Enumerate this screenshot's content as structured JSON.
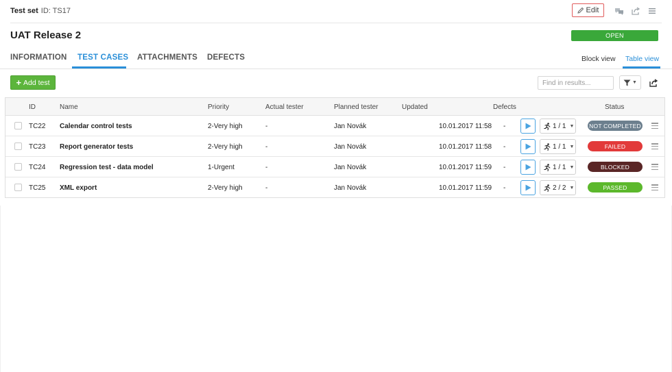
{
  "header": {
    "section_label": "Test set",
    "id_text": "ID: TS17",
    "edit_label": "Edit",
    "icons": [
      "comments-icon",
      "share-icon",
      "menu-icon"
    ]
  },
  "page": {
    "title": "UAT Release 2",
    "status": "OPEN",
    "status_color": "#3aa83a"
  },
  "tabs": [
    {
      "label": "INFORMATION",
      "active": false
    },
    {
      "label": "TEST CASES",
      "active": true
    },
    {
      "label": "ATTACHMENTS",
      "active": false
    },
    {
      "label": "DEFECTS",
      "active": false
    }
  ],
  "views": [
    {
      "label": "Block view",
      "active": false
    },
    {
      "label": "Table view",
      "active": true
    }
  ],
  "toolbar": {
    "add_label": "Add test",
    "search_placeholder": "Find in results...",
    "accent": "#2a8fd8"
  },
  "table": {
    "columns": [
      "ID",
      "Name",
      "Priority",
      "Actual tester",
      "Planned tester",
      "Updated",
      "Defects",
      "Status"
    ],
    "rows": [
      {
        "id": "TC22",
        "name": "Calendar control tests",
        "priority": "2-Very high",
        "actual_tester": "-",
        "planned_tester": "Jan Novák",
        "updated": "10.01.2017 11:58",
        "defects": "-",
        "runs": "1 / 1",
        "status": "NOT COMPLETED",
        "status_color": "#6c7f8e"
      },
      {
        "id": "TC23",
        "name": "Report generator tests",
        "priority": "2-Very high",
        "actual_tester": "-",
        "planned_tester": "Jan Novák",
        "updated": "10.01.2017 11:58",
        "defects": "-",
        "runs": "1 / 1",
        "status": "FAILED",
        "status_color": "#e23a3a"
      },
      {
        "id": "TC24",
        "name": "Regression test - data model",
        "priority": "1-Urgent",
        "actual_tester": "-",
        "planned_tester": "Jan Novák",
        "updated": "10.01.2017 11:59",
        "defects": "-",
        "runs": "1 / 1",
        "status": "BLOCKED",
        "status_color": "#5a2626"
      },
      {
        "id": "TC25",
        "name": "XML export",
        "priority": "2-Very high",
        "actual_tester": "-",
        "planned_tester": "Jan Novák",
        "updated": "10.01.2017 11:59",
        "defects": "-",
        "runs": "2 / 2",
        "status": "PASSED",
        "status_color": "#5cb82c"
      }
    ]
  }
}
